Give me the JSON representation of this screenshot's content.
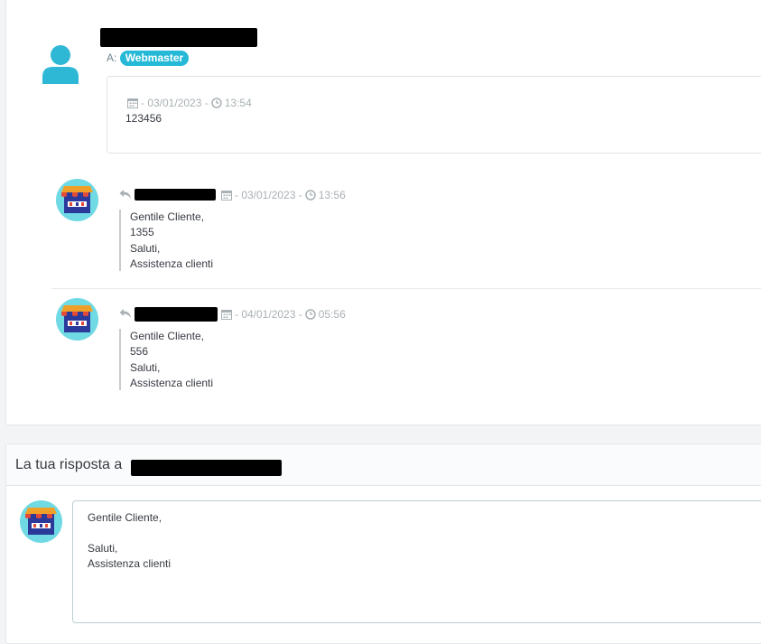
{
  "thread": {
    "main_message": {
      "to_prefix": "A:",
      "recipient_badge": "Webmaster",
      "date": "- 03/01/2023 -",
      "time": "13:54",
      "body": "123456"
    },
    "replies": [
      {
        "date": "- 03/01/2023 -",
        "time": "13:56",
        "lines": [
          "Gentile Cliente,",
          "1355",
          "Saluti,",
          "Assistenza clienti"
        ]
      },
      {
        "date": "- 04/01/2023 -",
        "time": "05:56",
        "lines": [
          "Gentile Cliente,",
          "556",
          "Saluti,",
          "Assistenza clienti"
        ]
      }
    ]
  },
  "reply_form": {
    "title": "La tua risposta a",
    "textarea_lines": [
      "Gentile Cliente,",
      "",
      "Saluti,",
      "Assistenza clienti"
    ]
  },
  "colors": {
    "accent": "#25b9d7",
    "meta_text": "#a9b1b5"
  },
  "icons": {
    "user_avatar": "user-icon",
    "calendar": "calendar-icon",
    "clock": "clock-icon",
    "reply": "reply-icon",
    "shop_avatar": "shop-avatar-icon"
  }
}
